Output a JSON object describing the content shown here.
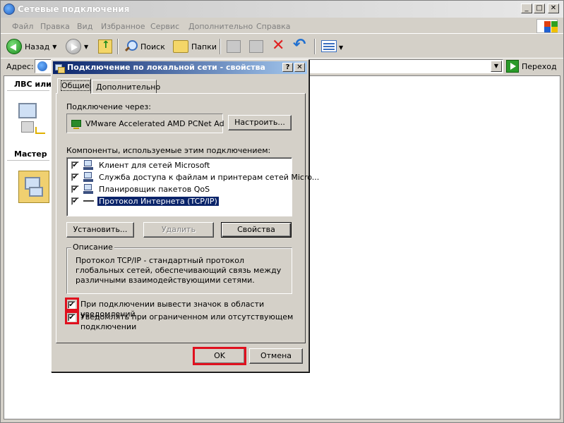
{
  "window": {
    "title": "Сетевые подключения",
    "controls": [
      "_",
      "□",
      "✕"
    ]
  },
  "menu": [
    "Файл",
    "Правка",
    "Вид",
    "Избранное",
    "Сервис",
    "Дополнительно",
    "Справка"
  ],
  "toolbar": {
    "back_label": "Назад",
    "search_label": "Поиск",
    "folders_label": "Папки"
  },
  "address": {
    "label": "Адрес:",
    "value": "",
    "go_label": "Переход"
  },
  "sidebar": {
    "section1_label": "ЛВС или в",
    "section2_label": "Мастер"
  },
  "dialog": {
    "title": "Подключение по локальной сети - свойства",
    "controls": [
      "?",
      "✕"
    ],
    "tabs": [
      "Общие",
      "Дополнительно"
    ],
    "connect_via_label": "Подключение через:",
    "adapter_name": "VMware Accelerated AMD PCNet Ad",
    "configure_button": "Настроить...",
    "components_label": "Компоненты, используемые этим подключением:",
    "components": [
      {
        "label": "Клиент для сетей Microsoft",
        "checked": true,
        "icon": "client-icon"
      },
      {
        "label": "Служба доступа к файлам и принтерам сетей Micro...",
        "checked": true,
        "icon": "service-icon"
      },
      {
        "label": "Планировщик пакетов QoS",
        "checked": true,
        "icon": "service-icon"
      },
      {
        "label": "Протокол Интернета (TCP/IP)",
        "checked": true,
        "icon": "protocol-icon",
        "selected": true
      }
    ],
    "install_button": "Установить...",
    "remove_button": "Удалить",
    "properties_button": "Свойства",
    "description_legend": "Описание",
    "description_text": "Протокол TCP/IP - стандартный протокол глобальных сетей, обеспечивающий связь между различными взаимодействующими сетями.",
    "option_show_icon": "При подключении вывести значок в области уведомлений",
    "option_notify": "Уведомлять при ограниченном или отсутствующем подключении",
    "ok_button": "OK",
    "cancel_button": "Отмена"
  },
  "colors": {
    "dialog_title_start": "#0a246a",
    "dialog_title_end": "#a6caf0",
    "highlight": "#e0101e",
    "face": "#d4d0c8"
  }
}
